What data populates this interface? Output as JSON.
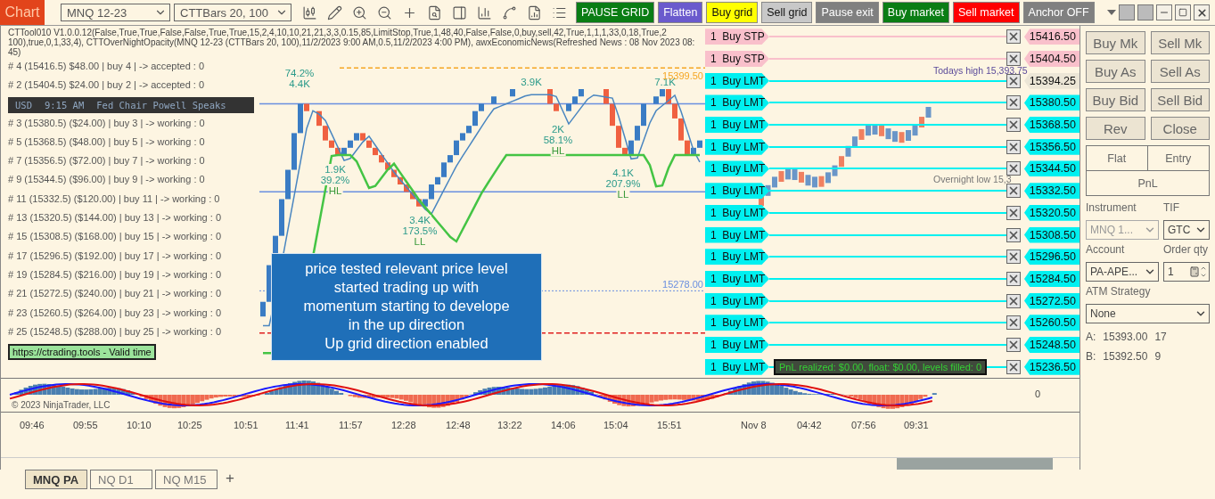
{
  "toolbar": {
    "title": "Chart",
    "instrument": "MNQ 12-23",
    "bar_type": "CTTBars 20, 100",
    "buttons": [
      {
        "label": "PAUSE GRID",
        "color": "#0a7d14"
      },
      {
        "label": "Flatten",
        "color": "#6a5acd"
      },
      {
        "label": "Buy grid",
        "color": "#ffff00"
      },
      {
        "label": "Sell grid",
        "color": "#c8c8c8"
      },
      {
        "label": "Pause exit",
        "color": "#808080"
      },
      {
        "label": "Buy market",
        "color": "#0a7d14"
      },
      {
        "label": "Sell market",
        "color": "#ff0000"
      },
      {
        "label": "Anchor OFF",
        "color": "#808080"
      }
    ]
  },
  "chart": {
    "header": [
      "CTTool010 V1.0.0.12(False,True,True,False,False,True,True,15,2,4,10,10,21,21,3,3,0.15,85,LimitStop,True,1,48,40,False,False,0,buy,sell,42,True,1,1,1,33,0,18,True,2",
      "100),true,0,1,33,4), CTTOverNightOpacity(MNQ 12-23 (CTTBars 20, 100),11/2/2023 9:00 AM,0.5,11/2/2023 4:00 PM), awxEconomicNews(Refreshed News : 08 Nov 2023 08:45)"
    ],
    "grid_levels": [
      "# 4 (15416.5) $48.00 | buy 4 | -> accepted : 0",
      "# 2 (15404.5) $24.00 | buy 2 | -> accepted : 0",
      "# 3 (15380.5) ($24.00) | buy 3 | -> working : 0",
      "# 5 (15368.5) ($48.00) | buy 5 | -> working : 0",
      "# 7 (15356.5) ($72.00) | buy 7 | -> working : 0",
      "# 9 (15344.5) ($96.00) | buy 9 | -> working : 0",
      "# 11 (15332.5) ($120.00) | buy 11 | -> working : 0",
      "# 13 (15320.5) ($144.00) | buy 13 | -> working : 0",
      "# 15 (15308.5) ($168.00) | buy 15 | -> working : 0",
      "# 17 (15296.5) ($192.00) | buy 17 | -> working : 0",
      "# 19 (15284.5) ($216.00) | buy 19 | -> working : 0",
      "# 21 (15272.5) ($240.00) | buy 21 | -> working : 0",
      "# 23 (15260.5) ($264.00) | buy 23 | -> working : 0",
      "# 25 (15248.5) ($288.00) | buy 25 | -> working : 0"
    ],
    "news": {
      "currency": "USD",
      "time": "9:15 AM",
      "title": "Fed Chair Powell Speaks"
    },
    "license": "https://ctrading.tools - Valid time",
    "swing_labels": [
      [
        "74.2%",
        "4.4K"
      ],
      [
        "1.9K",
        "39.2%",
        "HL"
      ],
      [
        "3.4K",
        "173.5%",
        "LL"
      ],
      [
        "2K",
        "58.1%",
        "HL"
      ],
      [
        "4.1K",
        "207.9%",
        "LL"
      ],
      [
        "3.9K"
      ],
      [
        "7.1K"
      ]
    ],
    "levels": [
      {
        "label": "15399.50",
        "color": "#f5a623"
      },
      {
        "label": "15278.00",
        "color": "#6a8fe0"
      }
    ],
    "session_labels": [
      "Todays high 15,393.75",
      "Overnight low 15,3"
    ],
    "note": [
      "price tested relevant price level",
      "started trading up with",
      "momentum starting to develope",
      "in the up direction",
      "Up grid direction enabled"
    ],
    "pnl": "PnL realized: $0.00, float: $0.00, levels filled: 0",
    "orders": [
      {
        "label": "1  Buy STP",
        "kind": "stop",
        "price": "15416.50",
        "price_is_last": false
      },
      {
        "label": "1  Buy STP",
        "kind": "stop",
        "price": "15404.50",
        "price_is_last": false
      },
      {
        "label": "1  Buy LMT",
        "kind": "limit",
        "price": "15394.25",
        "price_is_last": true
      },
      {
        "label": "1  Buy LMT",
        "kind": "limit",
        "price": "15380.50",
        "price_is_last": false
      },
      {
        "label": "1  Buy LMT",
        "kind": "limit",
        "price": "15368.50",
        "price_is_last": false
      },
      {
        "label": "1  Buy LMT",
        "kind": "limit",
        "price": "15356.50",
        "price_is_last": false
      },
      {
        "label": "1  Buy LMT",
        "kind": "limit",
        "price": "15344.50",
        "price_is_last": false
      },
      {
        "label": "1  Buy LMT",
        "kind": "limit",
        "price": "15332.50",
        "price_is_last": false
      },
      {
        "label": "1  Buy LMT",
        "kind": "limit",
        "price": "15320.50",
        "price_is_last": false
      },
      {
        "label": "1  Buy LMT",
        "kind": "limit",
        "price": "15308.50",
        "price_is_last": false
      },
      {
        "label": "1  Buy LMT",
        "kind": "limit",
        "price": "15296.50",
        "price_is_last": false
      },
      {
        "label": "1  Buy LMT",
        "kind": "limit",
        "price": "15284.50",
        "price_is_last": false
      },
      {
        "label": "1  Buy LMT",
        "kind": "limit",
        "price": "15272.50",
        "price_is_last": false
      },
      {
        "label": "1  Buy LMT",
        "kind": "limit",
        "price": "15260.50",
        "price_is_last": false
      },
      {
        "label": "1  Buy LMT",
        "kind": "limit",
        "price": "15248.50",
        "price_is_last": false
      },
      {
        "label": "1  Buy LMT",
        "kind": "limit",
        "price": "15236.50",
        "price_is_last": false
      }
    ],
    "copyright": "© 2023 NinjaTrader, LLC",
    "oscillator_axis": "0",
    "time_axis": [
      "09:46",
      "09:55",
      "10:10",
      "10:25",
      "10:51",
      "11:41",
      "11:57",
      "12:28",
      "12:48",
      "13:22",
      "14:06",
      "15:04",
      "15:51",
      "Nov 8",
      "04:42",
      "07:56",
      "09:31"
    ]
  },
  "tabs": [
    {
      "label": "MNQ PA",
      "selected": true
    },
    {
      "label": "NQ D1",
      "selected": false
    },
    {
      "label": "NQ M15",
      "selected": false
    }
  ],
  "add_tab": "+",
  "order_entry": {
    "buttons": [
      "Buy Mk",
      "Sell Mk",
      "Buy As",
      "Sell As",
      "Buy Bid",
      "Sell Bid",
      "Rev",
      "Close"
    ],
    "position": [
      "Flat",
      "Entry",
      "PnL"
    ],
    "fields": [
      {
        "label": "Instrument",
        "value": "MNQ 1...",
        "kind": "select",
        "disabled": true
      },
      {
        "label": "TIF",
        "value": "GTC",
        "kind": "select",
        "disabled": false
      },
      {
        "label": "Account",
        "value": "PA-APE...",
        "kind": "select",
        "disabled": false
      },
      {
        "label": "Order qty",
        "value": "1",
        "kind": "spinner",
        "disabled": false
      },
      {
        "label": "ATM Strategy",
        "value": "None",
        "kind": "select",
        "disabled": false
      }
    ],
    "quotes": [
      {
        "side": "A:",
        "price": "15393.00",
        "size": "17"
      },
      {
        "side": "B:",
        "price": "15392.50",
        "size": "9"
      }
    ]
  }
}
